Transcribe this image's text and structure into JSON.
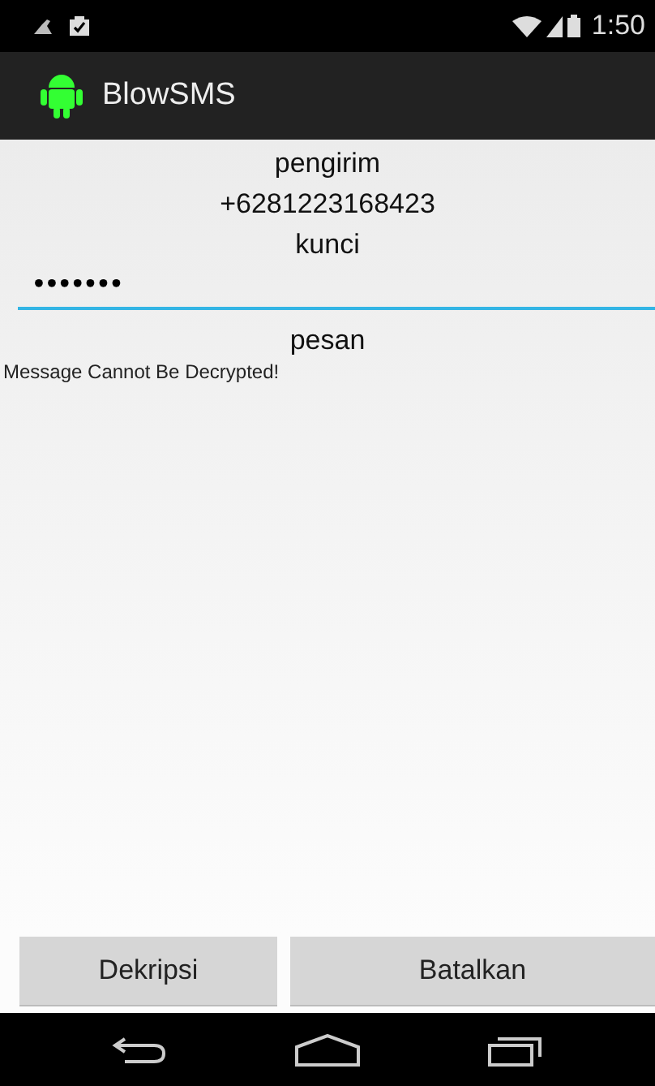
{
  "status_bar": {
    "time": "1:50"
  },
  "action_bar": {
    "title": "BlowSMS"
  },
  "sender": {
    "label": "pengirim",
    "value": "+6281223168423"
  },
  "key": {
    "label": "kunci",
    "value": "•••••••"
  },
  "message": {
    "label": "pesan",
    "text": "Message Cannot Be Decrypted!"
  },
  "buttons": [
    "Dekripsi",
    "Batalkan"
  ]
}
